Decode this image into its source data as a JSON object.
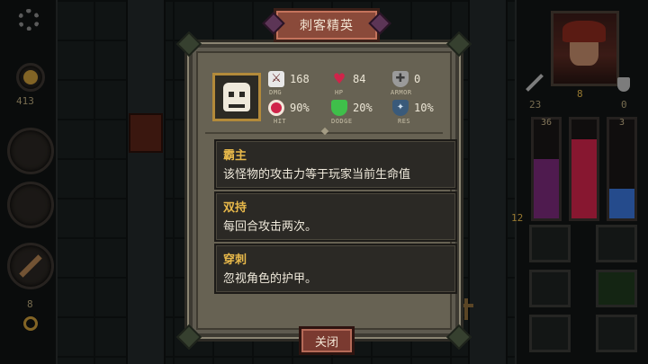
{
  "modal": {
    "title": "刺客精英",
    "stats": [
      {
        "key": "dmg",
        "value": "168",
        "label": "DMG",
        "icon": "sword-icon"
      },
      {
        "key": "hp",
        "value": "84",
        "label": "HP",
        "icon": "heart-icon"
      },
      {
        "key": "armor",
        "value": "0",
        "label": "ARMOR",
        "icon": "shield-icon"
      },
      {
        "key": "hit",
        "value": "90%",
        "label": "HIT",
        "icon": "target-icon"
      },
      {
        "key": "dodge",
        "value": "20%",
        "label": "DODGE",
        "icon": "green-shield-icon"
      },
      {
        "key": "res",
        "value": "10%",
        "label": "RES",
        "icon": "resist-shield-icon"
      }
    ],
    "abilities": [
      {
        "name": "霸主",
        "desc": "该怪物的攻击力等于玩家当前生命值"
      },
      {
        "name": "双持",
        "desc": "每回合攻击两次。"
      },
      {
        "name": "穿刺",
        "desc": "忽视角色的护甲。"
      }
    ],
    "close_label": "关闭"
  },
  "left_hud": {
    "gold": "413",
    "keys": "8"
  },
  "right_hud": {
    "attack": "23",
    "gold_count": "8",
    "defense": "0",
    "hp_vial": "36",
    "mana_vial": "3",
    "level": "12"
  },
  "colors": {
    "accent_gold": "#e7b84a",
    "hp_red": "#d0244a",
    "mana_blue": "#3a73d8",
    "title_plate": "#8a4a3a"
  }
}
